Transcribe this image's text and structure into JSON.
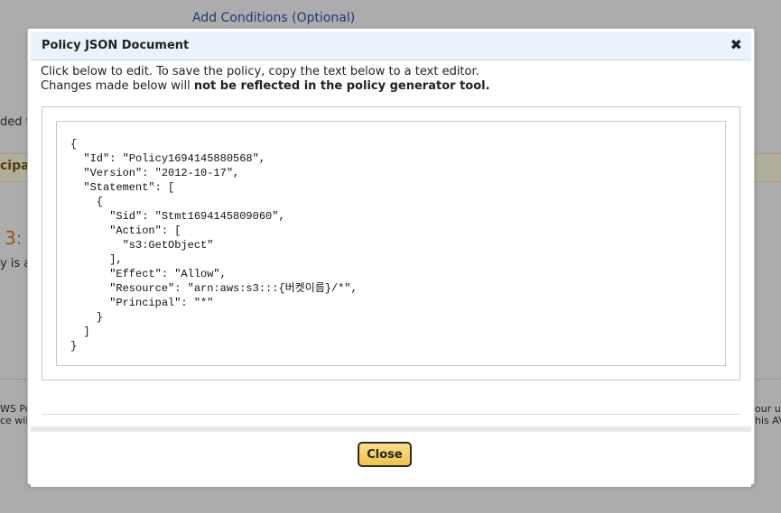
{
  "background": {
    "add_conditions_link": "Add Conditions (Optional)",
    "fragments": [
      "ded t",
      "cipal",
      "3:",
      "y is a",
      "WS Po",
      "ce wil",
      "our u",
      "his AV"
    ]
  },
  "dialog": {
    "title": "Policy JSON Document",
    "close_icon": "✖",
    "instructions_line1": "Click below to edit. To save the policy, copy the text below to a text editor.",
    "instructions_line2_prefix": "Changes made below will ",
    "instructions_line2_bold": "not be reflected in the policy generator tool.",
    "policy_json": "{\n  \"Id\": \"Policy1694145880568\",\n  \"Version\": \"2012-10-17\",\n  \"Statement\": [\n    {\n      \"Sid\": \"Stmt1694145809060\",\n      \"Action\": [\n        \"s3:GetObject\"\n      ],\n      \"Effect\": \"Allow\",\n      \"Resource\": \"arn:aws:s3:::{버켓이름}/*\",\n      \"Principal\": \"*\"\n    }\n  ]\n}",
    "close_button_label": "Close"
  }
}
